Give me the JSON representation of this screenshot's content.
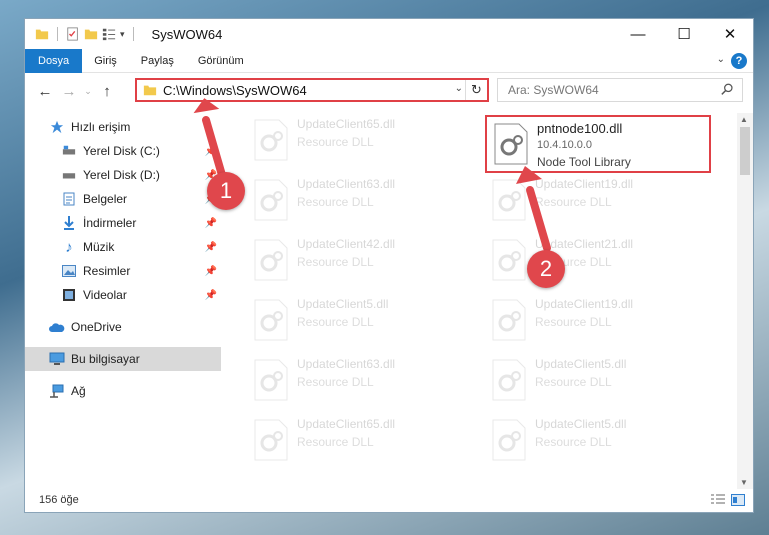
{
  "window": {
    "title": "SysWOW64",
    "controls": {
      "minimize": "—",
      "maximize": "☐",
      "close": "✕"
    }
  },
  "ribbon": {
    "tabs": [
      "Dosya",
      "Giriş",
      "Paylaş",
      "Görünüm"
    ],
    "help": "?"
  },
  "address": {
    "path": "C:\\Windows\\SysWOW64",
    "search_placeholder": "Ara: SysWOW64"
  },
  "sidebar": {
    "quick_access": "Hızlı erişim",
    "items": [
      {
        "label": "Yerel Disk (C:)",
        "icon": "drive-icon",
        "pinned": true
      },
      {
        "label": "Yerel Disk (D:)",
        "icon": "drive-icon",
        "pinned": true
      },
      {
        "label": "Belgeler",
        "icon": "documents-icon",
        "pinned": true
      },
      {
        "label": "İndirmeler",
        "icon": "downloads-icon",
        "pinned": true
      },
      {
        "label": "Müzik",
        "icon": "music-icon",
        "pinned": true
      },
      {
        "label": "Resimler",
        "icon": "pictures-icon",
        "pinned": true
      },
      {
        "label": "Videolar",
        "icon": "videos-icon",
        "pinned": true
      }
    ],
    "onedrive": "OneDrive",
    "this_pc": "Bu bilgisayar",
    "network": "Ağ"
  },
  "files": {
    "highlighted": {
      "name": "pntnode100.dll",
      "version": "10.4.10.0.0",
      "description": "Node Tool Library"
    },
    "left_column": [
      {
        "name": "UpdateClient65.dll",
        "description": "Resource DLL"
      },
      {
        "name": "UpdateClient63.dll",
        "description": "Resource DLL"
      },
      {
        "name": "UpdateClient42.dll",
        "description": "Resource DLL"
      },
      {
        "name": "UpdateClient5.dll",
        "description": "Resource DLL"
      },
      {
        "name": "UpdateClient63.dll",
        "description": "Resource DLL"
      },
      {
        "name": "UpdateClient65.dll",
        "description": "Resource DLL"
      }
    ],
    "right_column": [
      {
        "name": "UpdateClient19.dll",
        "description": "Resource DLL"
      },
      {
        "name": "UpdateClient21.dll",
        "description": "Resource DLL"
      },
      {
        "name": "UpdateClient19.dll",
        "description": "Resource DLL"
      },
      {
        "name": "UpdateClient5.dll",
        "description": "Resource DLL"
      },
      {
        "name": "UpdateClient5.dll",
        "description": "Resource DLL"
      }
    ]
  },
  "status": {
    "count": "156 öğe"
  },
  "annotations": {
    "step1": "1",
    "step2": "2",
    "color": "#e0474c"
  }
}
